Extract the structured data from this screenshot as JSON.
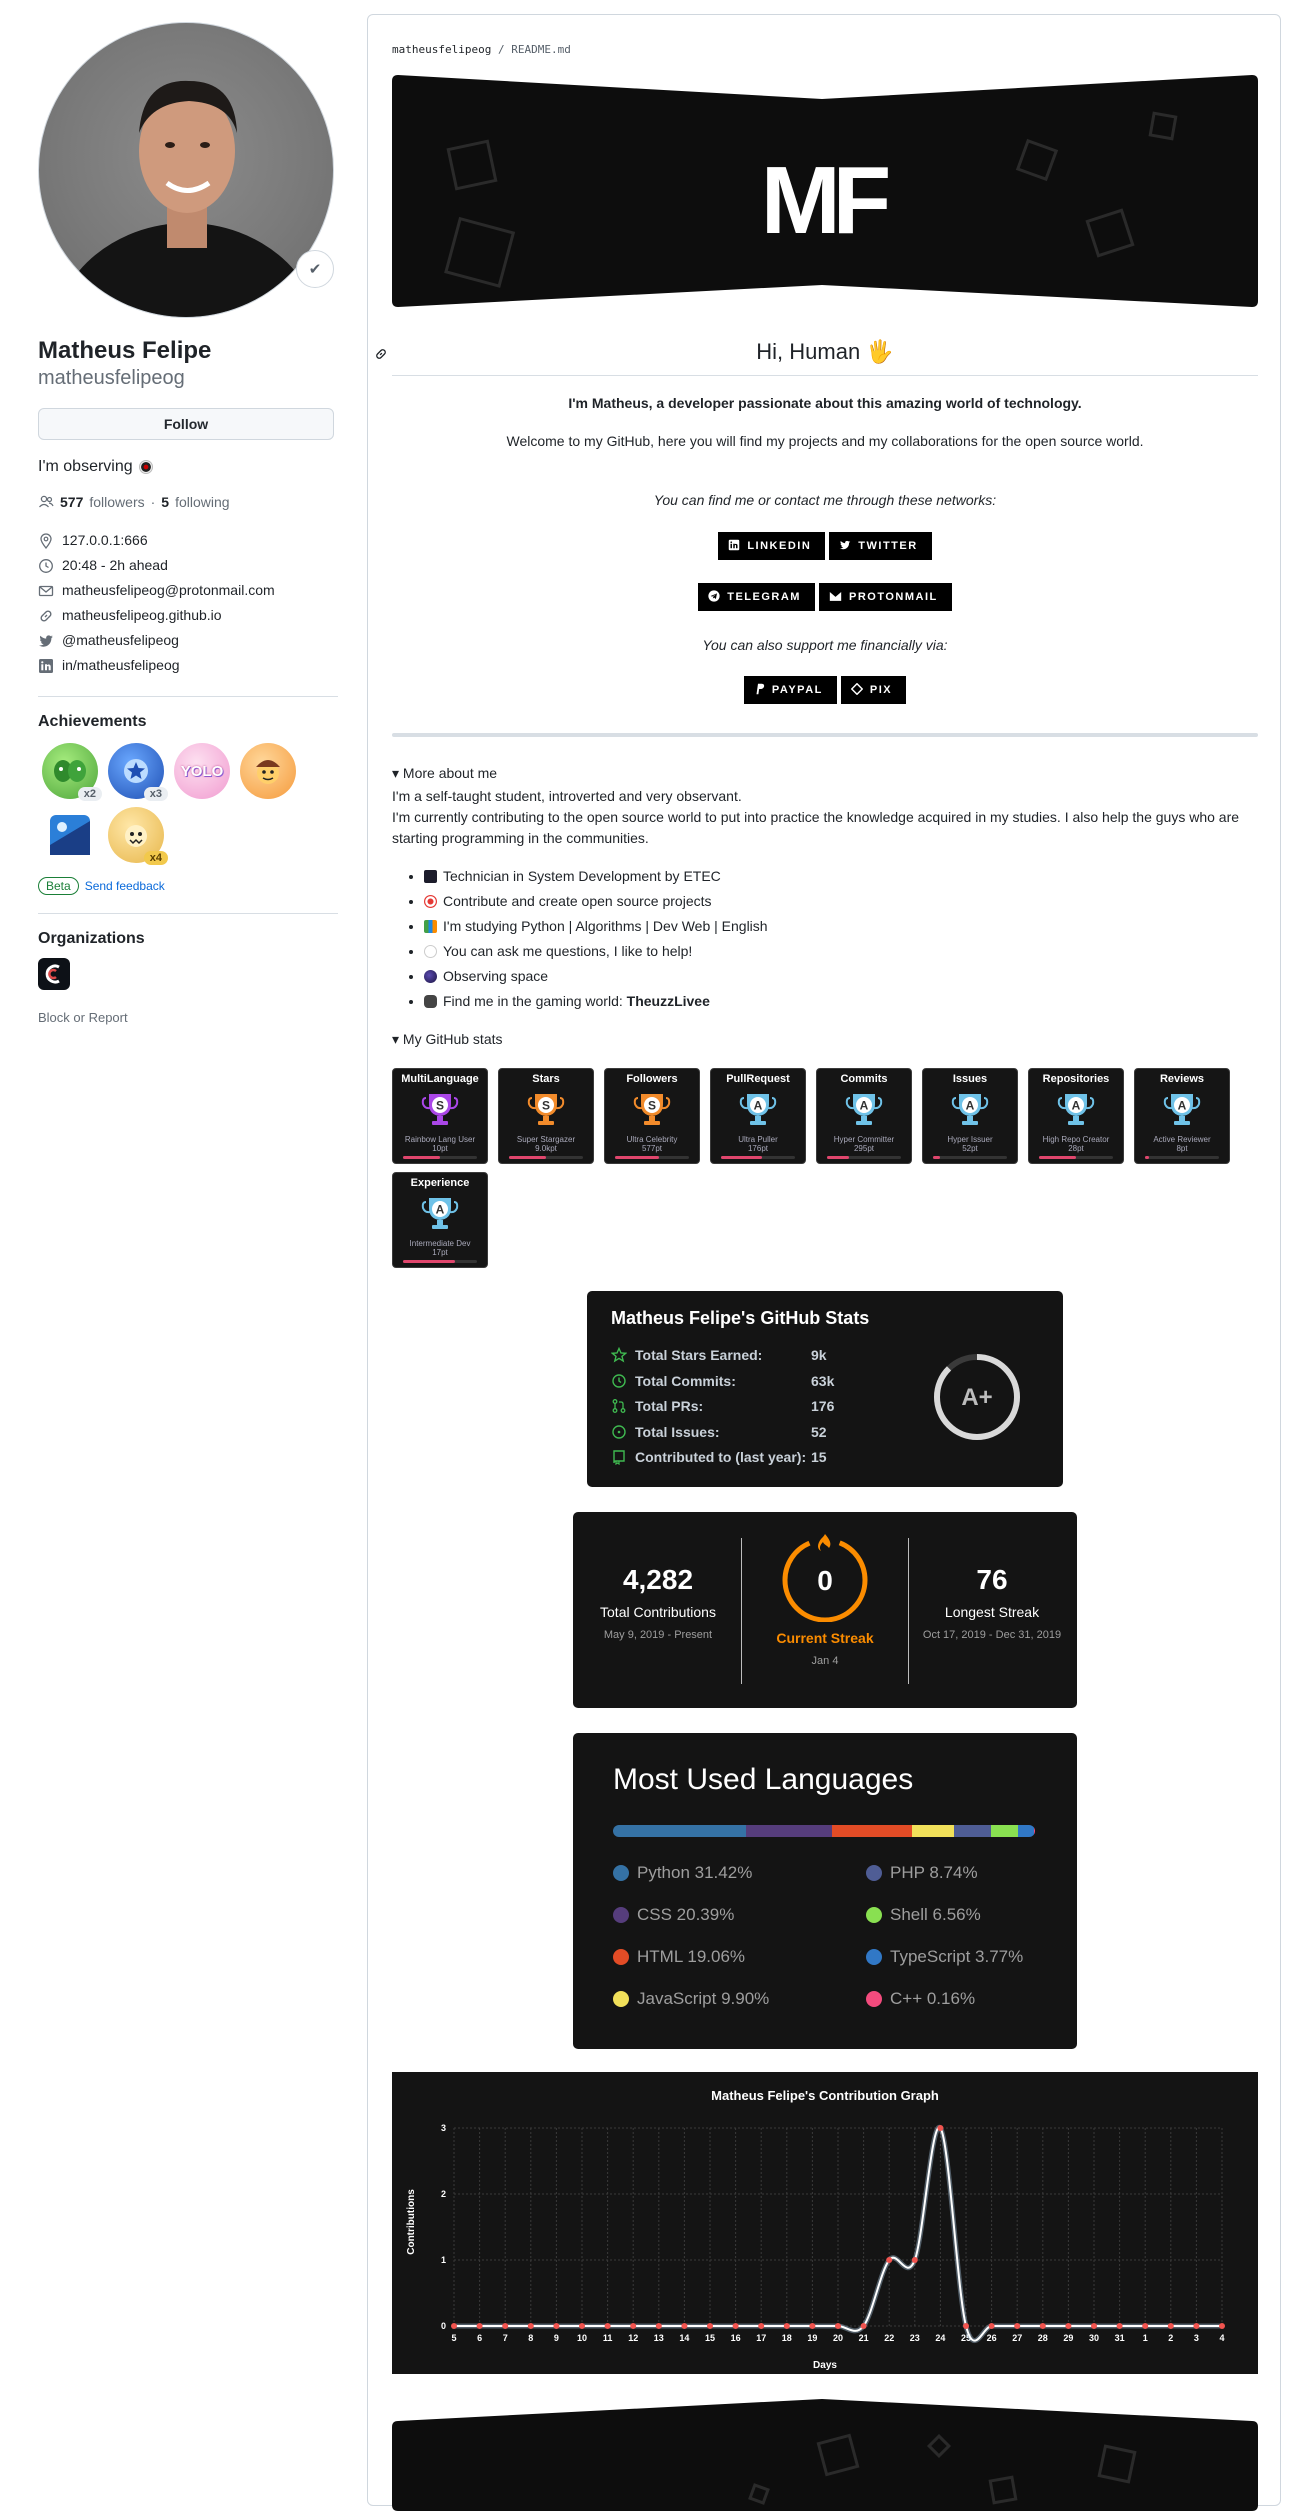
{
  "profile": {
    "name": "Matheus Felipe",
    "login": "matheusfelipeog",
    "follow_label": "Follow",
    "bio": "I'm observing",
    "followers_count": "577",
    "followers_label": "followers",
    "separator": "·",
    "following_count": "5",
    "following_label": "following",
    "location": "127.0.0.1:666",
    "local_time": "20:48 - 2h ahead",
    "email": "matheusfelipeog@protonmail.com",
    "website": "matheusfelipeog.github.io",
    "twitter": "@matheusfelipeog",
    "linkedin": "in/matheusfelipeog"
  },
  "achievements": {
    "title": "Achievements",
    "items": [
      {
        "name": "pair-extraordinaire",
        "count": "x2",
        "color": "#6fcf4f"
      },
      {
        "name": "starstruck",
        "count": "x3",
        "color": "#2f6bd6"
      },
      {
        "name": "yolo",
        "count": "",
        "color": "#f5a0c8"
      },
      {
        "name": "quickdraw",
        "count": "",
        "color": "#f7a64a"
      },
      {
        "name": "arctic-code-vault",
        "count": "",
        "color": "#2b7fd8"
      },
      {
        "name": "pull-shark",
        "count": "x4",
        "color": "#f6c443"
      }
    ],
    "beta_label": "Beta",
    "feedback_label": "Send feedback"
  },
  "organizations": {
    "title": "Organizations",
    "block_label": "Block or Report"
  },
  "readme": {
    "path_user": "matheusfelipeog",
    "path_sep": "/",
    "path_file": "README.md",
    "banner_logo": "MF",
    "greeting": "Hi, Human 🖐️",
    "intro": "I'm Matheus, a developer passionate about this amazing world of technology.",
    "welcome": "Welcome to my GitHub, here you will find my projects and my collaborations for the open source world.",
    "contact_text": "You can find me or contact me through these networks:",
    "social": [
      "LINKEDIN",
      "TWITTER",
      "TELEGRAM",
      "PROTONMAIL"
    ],
    "support_text": "You can also support me financially via:",
    "support": [
      "PAYPAL",
      "PIX"
    ],
    "more_about": "▾ More about me",
    "about1": "I'm a self-taught student, introverted and very observant.",
    "about2": "I'm currently contributing to the open source world to put into practice the knowledge acquired in my studies. I also help the guys who are starting programming in the communities.",
    "bullets": [
      "Technician in System Development by ETEC",
      "Contribute and create open source projects",
      "I'm studying Python | Algorithms | Dev Web | English",
      "You can ask me questions, I like to help!",
      "Observing space",
      "Find me in the gaming world: "
    ],
    "gaming_name": "TheuzzLivee",
    "github_stats_label": "▾ My GitHub stats"
  },
  "trophies": [
    {
      "title": "MultiLanguage",
      "rank": "S",
      "name": "Rainbow Lang User",
      "points": "10pt",
      "progress": 0.5,
      "color": "#ab47e8"
    },
    {
      "title": "Stars",
      "rank": "S",
      "name": "Super Stargazer",
      "points": "9.0kpt",
      "progress": 0.5,
      "color": "#f28b2b"
    },
    {
      "title": "Followers",
      "rank": "S",
      "name": "Ultra Celebrity",
      "points": "577pt",
      "progress": 0.6,
      "color": "#f28b2b"
    },
    {
      "title": "PullRequest",
      "rank": "A",
      "name": "Ultra Puller",
      "points": "176pt",
      "progress": 0.55,
      "color": "#6fc2e8"
    },
    {
      "title": "Commits",
      "rank": "A",
      "name": "Hyper Committer",
      "points": "295pt",
      "progress": 0.3,
      "color": "#6fc2e8"
    },
    {
      "title": "Issues",
      "rank": "A",
      "name": "Hyper Issuer",
      "points": "52pt",
      "progress": 0.1,
      "color": "#6fc2e8"
    },
    {
      "title": "Repositories",
      "rank": "A",
      "name": "High Repo Creator",
      "points": "28pt",
      "progress": 0.5,
      "color": "#6fc2e8"
    },
    {
      "title": "Reviews",
      "rank": "A",
      "name": "Active Reviewer",
      "points": "8pt",
      "progress": 0.05,
      "color": "#6fc2e8"
    },
    {
      "title": "Experience",
      "rank": "A",
      "name": "Intermediate Dev",
      "points": "17pt",
      "progress": 0.7,
      "color": "#6fc2e8"
    }
  ],
  "stats_card": {
    "title": "Matheus Felipe's GitHub Stats",
    "rows": [
      {
        "label": "Total Stars Earned:",
        "value": "9k",
        "icon": "star-icon"
      },
      {
        "label": "Total Commits:",
        "value": "63k",
        "icon": "history-icon"
      },
      {
        "label": "Total PRs:",
        "value": "176",
        "icon": "pull-request-icon"
      },
      {
        "label": "Total Issues:",
        "value": "52",
        "icon": "issue-icon"
      },
      {
        "label": "Contributed to (last year):",
        "value": "15",
        "icon": "repo-icon"
      }
    ],
    "grade": "A+",
    "accent": "#3fb950"
  },
  "streak_card": {
    "total": "4,282",
    "total_label": "Total Contributions",
    "total_range": "May 9, 2019 - Present",
    "current": "0",
    "current_label": "Current Streak",
    "current_date": "Jan 4",
    "longest": "76",
    "longest_label": "Longest Streak",
    "longest_range": "Oct 17, 2019 - Dec 31, 2019",
    "accent": "#fb8c00"
  },
  "languages_card": {
    "title": "Most Used Languages",
    "langs": [
      {
        "name": "Python 31.42%",
        "pct": 31.42,
        "color": "#3572A5"
      },
      {
        "name": "PHP 8.74%",
        "pct": 8.74,
        "color": "#4F5D95"
      },
      {
        "name": "CSS 20.39%",
        "pct": 20.39,
        "color": "#563d7c"
      },
      {
        "name": "Shell 6.56%",
        "pct": 6.56,
        "color": "#89e051"
      },
      {
        "name": "HTML 19.06%",
        "pct": 19.06,
        "color": "#e34c26"
      },
      {
        "name": "TypeScript 3.77%",
        "pct": 3.77,
        "color": "#3178c6"
      },
      {
        "name": "JavaScript 9.90%",
        "pct": 9.9,
        "color": "#f1e05a"
      },
      {
        "name": "C++ 0.16%",
        "pct": 0.16,
        "color": "#f34b7d"
      }
    ]
  },
  "chart_data": {
    "type": "line",
    "title": "Matheus Felipe's Contribution Graph",
    "xlabel": "Days",
    "ylabel": "Contributions",
    "x": [
      "5",
      "6",
      "7",
      "8",
      "9",
      "10",
      "11",
      "12",
      "13",
      "14",
      "15",
      "16",
      "17",
      "18",
      "19",
      "20",
      "21",
      "22",
      "23",
      "24",
      "25",
      "26",
      "27",
      "28",
      "29",
      "30",
      "31",
      "1",
      "2",
      "3",
      "4"
    ],
    "series": [
      {
        "values": [
          0,
          0,
          0,
          0,
          0,
          0,
          0,
          0,
          0,
          0,
          0,
          0,
          0,
          0,
          0,
          0,
          0,
          1,
          1,
          3,
          0,
          0,
          0,
          0,
          0,
          0,
          0,
          0,
          0,
          0,
          0
        ]
      }
    ],
    "ylim": [
      0,
      3
    ],
    "yticks": [
      0,
      1,
      2,
      3
    ],
    "grid": true,
    "line_color": "#ffffff",
    "point_color": "#f0544f"
  }
}
